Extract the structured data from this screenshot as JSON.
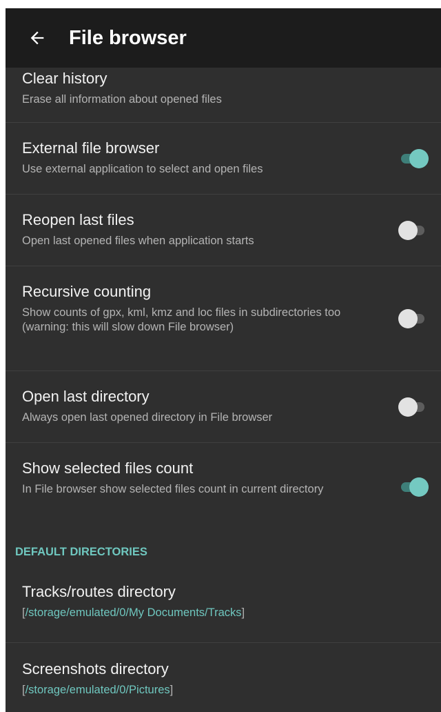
{
  "appbar": {
    "title": "File browser",
    "back_icon": "arrow-left-icon"
  },
  "colors": {
    "appbar_bg": "#1c1c1c",
    "screen_bg": "#2f2f2f",
    "accent": "#74c9c1",
    "divider": "#404040"
  },
  "settings": [
    {
      "title": "Clear history",
      "subtitle": "Erase all information about opened files"
    },
    {
      "title": "External file browser",
      "subtitle": "Use external application to select and open files",
      "switch_on": true
    },
    {
      "title": "Reopen last files",
      "subtitle": "Open last opened files when application starts",
      "switch_on": false
    },
    {
      "title": "Recursive counting",
      "subtitle": "Show counts of gpx, kml, kmz and loc files in subdirectories too (warning: this will slow down File browser)",
      "switch_on": false
    },
    {
      "title": "Open last directory",
      "subtitle": "Always open last opened directory in File browser",
      "switch_on": false
    },
    {
      "title": "Show selected files count",
      "subtitle": "In File browser show selected files count in current directory",
      "switch_on": true
    }
  ],
  "section_default_dirs": {
    "header": "DEFAULT DIRECTORIES",
    "items": [
      {
        "title": "Tracks/routes directory",
        "open_bracket": "[",
        "path": "/storage/emulated/0/My Documents/Tracks",
        "close_bracket": "]"
      },
      {
        "title": "Screenshots directory",
        "open_bracket": "[",
        "path": "/storage/emulated/0/Pictures",
        "close_bracket": "]"
      }
    ]
  }
}
